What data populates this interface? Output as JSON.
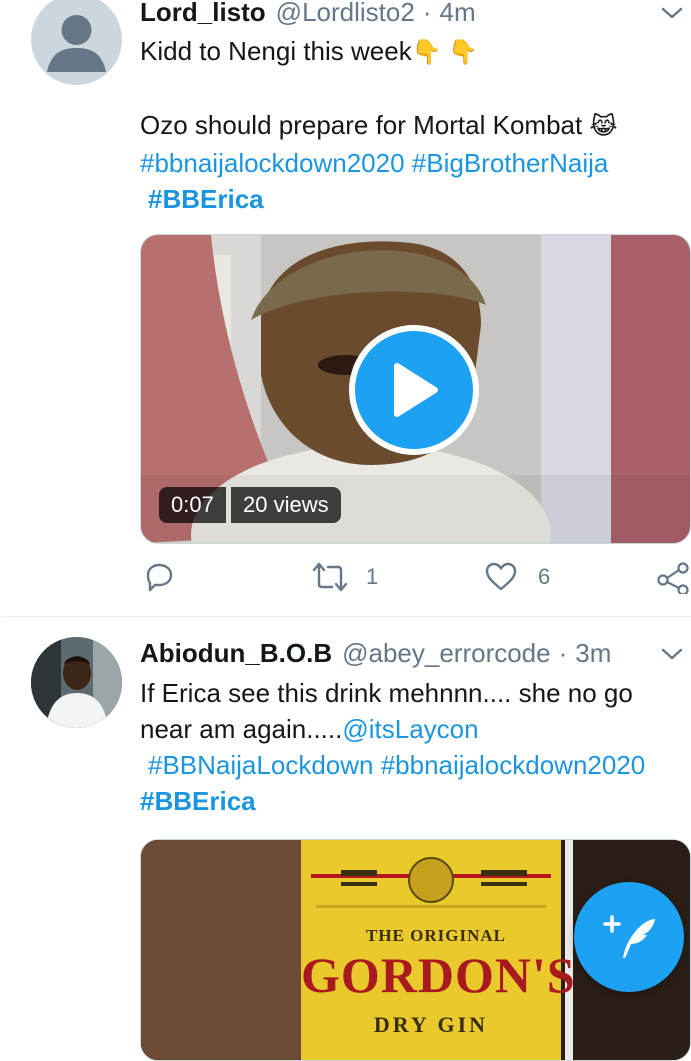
{
  "tweets": [
    {
      "name": "Lord_listo",
      "handle": "@Lordlisto2",
      "dot": "·",
      "time": "4m",
      "line1": "Kidd to Nengi this week",
      "line1_emoji": "👇 👇",
      "line2": "Ozo should prepare for Mortal Kombat",
      "line2_emoji": "😹",
      "tag1": "#bbnaijalockdown2020",
      "tag2": "#BigBrotherNaija",
      "tag3": "#BBErica",
      "video_time": "0:07",
      "video_views": "20 views",
      "retweets": "1",
      "likes": "6"
    },
    {
      "name": "Abiodun_B.O.B",
      "handle": "@abey_errorcode",
      "dot": "·",
      "time": "3m",
      "line1": "If Erica see this drink mehnnn.... she no go",
      "line2": "near am again.....",
      "mention": "@itsLaycon",
      "tag1": "#BBNaijaLockdown",
      "tag2": "#bbnaijalockdown2020",
      "tag3": "#BBErica",
      "label_top": "THE ORIGINAL",
      "label_brand": "GORDON'S",
      "label_bottom": "DRY GIN"
    }
  ],
  "colors": {
    "accent": "#1da1f2",
    "link": "#1b95e0",
    "muted": "#657786"
  }
}
